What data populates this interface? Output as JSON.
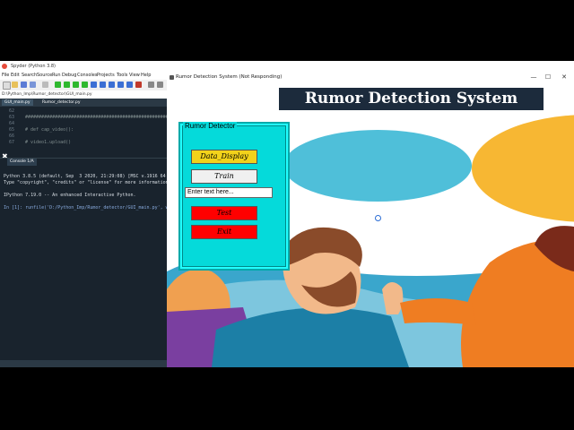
{
  "spyder": {
    "title": "Spyder (Python 3.8)",
    "menu": [
      "File",
      "Edit",
      "Search",
      "Source",
      "Run",
      "Debug",
      "Consoles",
      "Projects",
      "Tools",
      "View",
      "Help"
    ],
    "path": "D:\\Python_Imp\\Rumor_detector\\GUI_main.py",
    "file_tabs": [
      "GUI_main.py",
      "Rumor_detector.py"
    ],
    "editor_lines": [
      {
        "num": "62",
        "code": ""
      },
      {
        "num": "63",
        "code": "###########################################################"
      },
      {
        "num": "64",
        "code": ""
      },
      {
        "num": "65",
        "code": "# def cap_video():"
      },
      {
        "num": "66",
        "code": ""
      },
      {
        "num": "67",
        "code": "#     video1.upload()"
      }
    ],
    "console_tab": "Console 1/A",
    "console_lines": [
      "Python 3.8.5 (default, Sep  3 2020, 21:29:08) [MSC v.1916 64",
      "Type \"copyright\", \"credits\" or \"license\" for more information.",
      "",
      "IPython 7.19.0 -- An enhanced Interactive Python.",
      "",
      "In [1]: runfile('D:/Python_Imp/Rumor_detector/GUI_main.py', w"
    ]
  },
  "tk": {
    "title": "Rumor Detection System (Not Responding)",
    "controls": {
      "minimize": "—",
      "maximize": "☐",
      "close": "✕"
    },
    "banner": "Rumor Detection System",
    "panel_label": "Rumor Detector",
    "buttons": {
      "data_display": "Data_Display",
      "train": "Train",
      "test": "Test",
      "exit": "Exit"
    },
    "entry_value": "Enter text here...",
    "colors": {
      "panel": "#05dada",
      "data_display_bg": "#f2d21b",
      "train_bg": "#f0f0f0",
      "test_bg": "#ff0000",
      "exit_bg": "#ff0000",
      "banner_bg": "#1c2b3c"
    }
  }
}
